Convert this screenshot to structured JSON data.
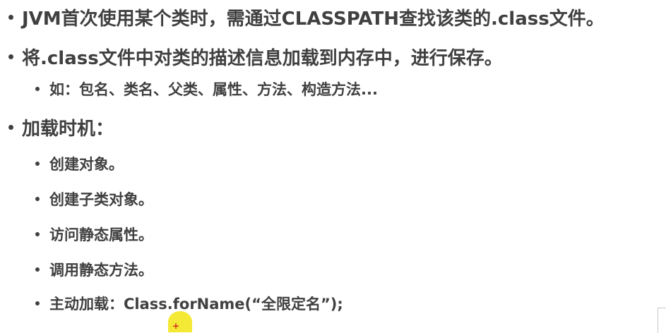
{
  "slide": {
    "items": [
      {
        "level": 1,
        "text": "JVM首次使用某个类时，需通过CLASSPATH查找该类的.class文件。"
      },
      {
        "level": 1,
        "text": "将.class文件中对类的描述信息加载到内存中，进行保存。"
      },
      {
        "level": 2,
        "text": "如：包名、类名、父类、属性、方法、构造方法..."
      },
      {
        "level": 1,
        "text": "加载时机："
      },
      {
        "level": 2,
        "text": "创建对象。"
      },
      {
        "level": 2,
        "text": "创建子类对象。"
      },
      {
        "level": 2,
        "text": "访问静态属性。"
      },
      {
        "level": 2,
        "text": "调用静态方法。"
      },
      {
        "level": 2,
        "text": "主动加载：Class.forName(“全限定名”);"
      }
    ]
  },
  "cursor": {
    "icon": "pointer-highlight-icon",
    "highlight_color": "#f3e82a",
    "mark": "+"
  }
}
